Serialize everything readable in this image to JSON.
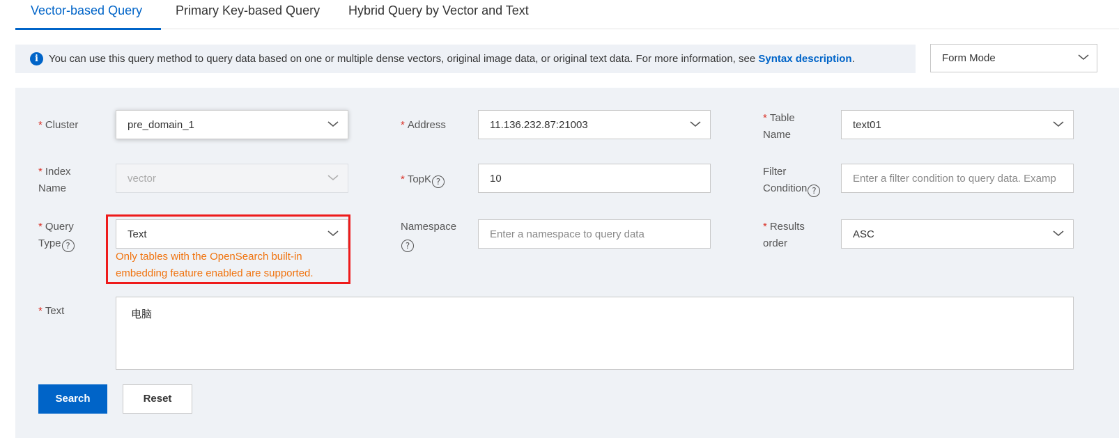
{
  "tabs": [
    {
      "label": "Vector-based Query",
      "active": true
    },
    {
      "label": "Primary Key-based Query",
      "active": false
    },
    {
      "label": "Hybrid Query by Vector and Text",
      "active": false
    }
  ],
  "info": {
    "icon": "info-icon",
    "text": "You can use this query method to query data based on one or multiple dense vectors, original image data, or original text data. For more information, see ",
    "link": "Syntax description",
    "suffix": "."
  },
  "mode_select": {
    "value": "Form Mode"
  },
  "form": {
    "cluster": {
      "label": "Cluster",
      "value": "pre_domain_1"
    },
    "address": {
      "label": "Address",
      "value": "11.136.232.87:21003"
    },
    "table_name": {
      "label_line1": "Table",
      "label_line2": "Name",
      "value": "text01"
    },
    "index_name": {
      "label_line1": "Index",
      "label_line2": "Name",
      "value": "vector"
    },
    "topk": {
      "label": "TopK",
      "value": "10"
    },
    "filter_condition": {
      "label_line1": "Filter",
      "label_line2": "Condition",
      "placeholder": "Enter a filter condition to query data. Examp"
    },
    "query_type": {
      "label_line1": "Query",
      "label_line2": "Type",
      "value": "Text",
      "warning_line1": "Only tables with the OpenSearch built-in",
      "warning_line2": "embedding feature enabled are supported."
    },
    "namespace": {
      "label": "Namespace",
      "placeholder": "Enter a namespace to query data"
    },
    "results_order": {
      "label_line1": "Results",
      "label_line2": "order",
      "value": "ASC"
    },
    "text": {
      "label": "Text",
      "value": "电脑"
    }
  },
  "buttons": {
    "search": "Search",
    "reset": "Reset"
  },
  "colors": {
    "accent": "#0064c8",
    "required": "#d93026",
    "warning": "#f0730e",
    "highlight": "#ee1b1b",
    "panel_bg": "#eff2f6"
  }
}
